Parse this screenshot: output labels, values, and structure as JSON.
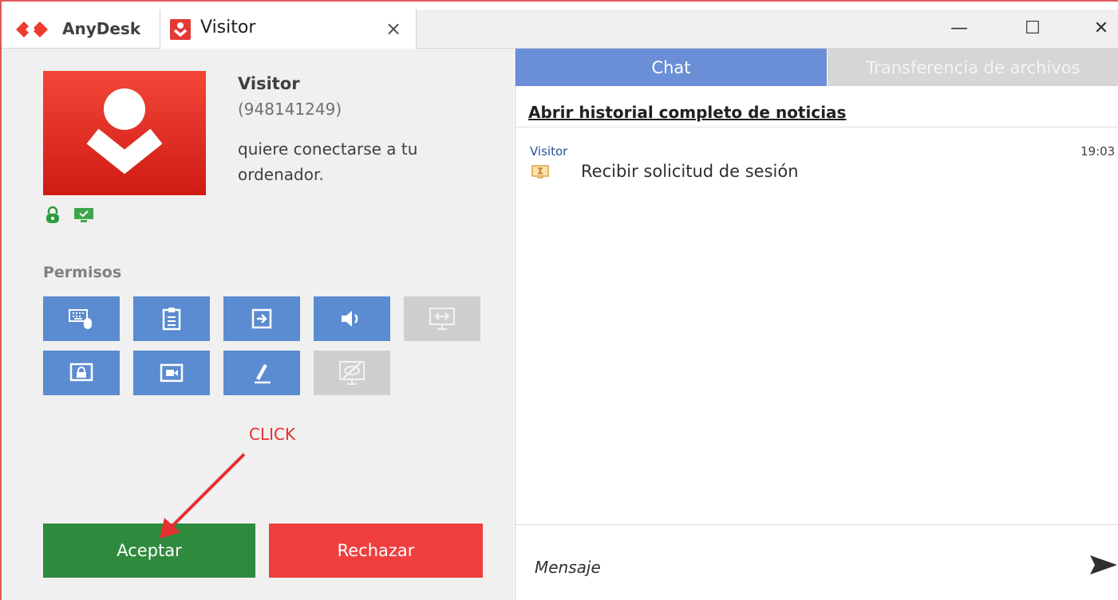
{
  "window": {
    "app_name": "AnyDesk",
    "session_tab_title": "Visitor",
    "tab_close": "×",
    "minimize": "—",
    "maximize": "☐",
    "close": "✕"
  },
  "request": {
    "name": "Visitor",
    "id": "(948141249)",
    "message": "quiere conectarse a tu ordenador."
  },
  "permissions": {
    "title": "Permisos",
    "items": [
      {
        "name": "keyboard-mouse",
        "enabled": true
      },
      {
        "name": "clipboard",
        "enabled": true
      },
      {
        "name": "file-transfer",
        "enabled": true
      },
      {
        "name": "audio",
        "enabled": true
      },
      {
        "name": "control-computer",
        "enabled": false
      },
      {
        "name": "lock-screen",
        "enabled": true
      },
      {
        "name": "record-session",
        "enabled": true
      },
      {
        "name": "draw",
        "enabled": true
      },
      {
        "name": "privacy-mode",
        "enabled": false
      }
    ]
  },
  "annotation": {
    "click_label": "CLICK",
    "color": "#e53030"
  },
  "actions": {
    "accept": "Aceptar",
    "reject": "Rechazar"
  },
  "chat": {
    "tab_chat": "Chat",
    "tab_files": "Transferencia de archivos",
    "history_link": "Abrir historial completo de noticias",
    "messages": [
      {
        "sender": "Visitor",
        "time": "19:03",
        "text": "Recibir solicitud de sesión"
      }
    ],
    "input_placeholder": "Mensaje"
  },
  "colors": {
    "accent_red": "#e53935",
    "accept_green": "#2f8a3d",
    "reject_red": "#ef3e3e",
    "perm_blue": "#5b8bd0",
    "chat_tab_blue": "#6b8fd6"
  }
}
